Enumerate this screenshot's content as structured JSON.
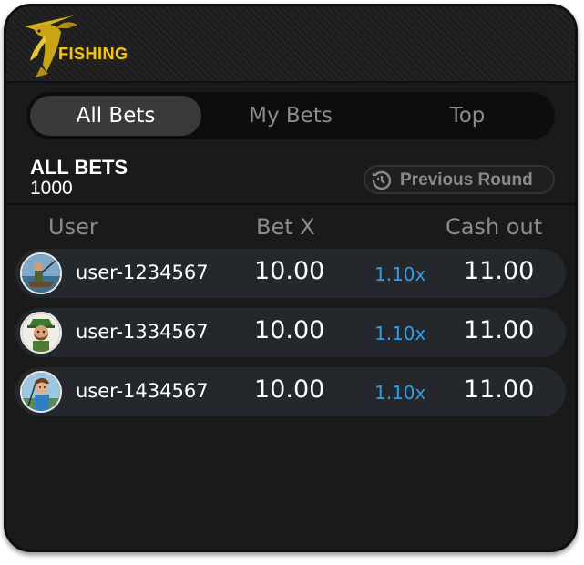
{
  "header": {
    "logo_text": "FISHING"
  },
  "tabs": [
    {
      "label": "All Bets",
      "active": true
    },
    {
      "label": "My Bets",
      "active": false
    },
    {
      "label": "Top",
      "active": false
    }
  ],
  "summary": {
    "title": "ALL BETS",
    "count": "1000",
    "previous_round_label": "Previous Round",
    "previous_round_icon": "history-icon"
  },
  "columns": {
    "user": "User",
    "bet": "Bet X",
    "cashout": "Cash out"
  },
  "bets": [
    {
      "user": "user-1234567",
      "bet": "10.00",
      "multiplier": "1.10x",
      "cashout": "11.00",
      "avatar": "fisherman-boat-avatar"
    },
    {
      "user": "user-1334567",
      "bet": "10.00",
      "multiplier": "1.10x",
      "cashout": "11.00",
      "avatar": "bearded-fisherman-avatar"
    },
    {
      "user": "user-1434567",
      "bet": "10.00",
      "multiplier": "1.10x",
      "cashout": "11.00",
      "avatar": "young-fisherman-avatar"
    }
  ],
  "colors": {
    "accent_gold": "#f2c51c",
    "multiplier_blue": "#2e9ee8",
    "panel_background": "#1a1a1a",
    "row_background": "#24272b"
  }
}
